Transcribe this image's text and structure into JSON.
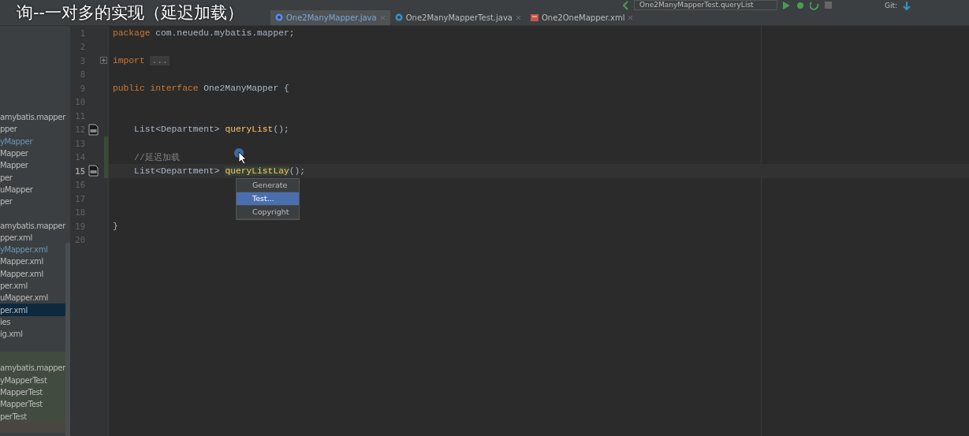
{
  "caption": "询--一对多的实现（延迟加载）",
  "toolbar": {
    "run_config": "One2ManyMapperTest.queryList",
    "vcs_label": "Git:"
  },
  "tabs": [
    {
      "label": "One2ManyMapper.java",
      "kind": "interface",
      "selected": true
    },
    {
      "label": "One2ManyMapperTest.java",
      "kind": "class",
      "selected": false
    },
    {
      "label": "One2OneMapper.xml",
      "kind": "xml",
      "selected": false
    }
  ],
  "sidebar": {
    "sections": [
      {
        "kind": "main",
        "items": [
          {
            "label": "amybatis.mapper",
            "color": "#bbbbbb",
            "selected": false
          },
          {
            "label": "pper",
            "color": "#bbbbbb",
            "selected": false
          },
          {
            "label": "yMapper",
            "color": "#6897bb",
            "selected": false
          },
          {
            "label": "Mapper",
            "color": "#bbbbbb",
            "selected": false
          },
          {
            "label": "Mapper",
            "color": "#bbbbbb",
            "selected": false
          },
          {
            "label": "per",
            "color": "#bbbbbb",
            "selected": false
          },
          {
            "label": "uMapper",
            "color": "#bbbbbb",
            "selected": false
          },
          {
            "label": "per",
            "color": "#bbbbbb",
            "selected": false
          }
        ]
      },
      {
        "kind": "main",
        "items": [
          {
            "label": "amybatis.mapper",
            "color": "#bbbbbb",
            "selected": false
          },
          {
            "label": "pper.xml",
            "color": "#bbbbbb",
            "selected": false
          },
          {
            "label": "yMapper.xml",
            "color": "#6897bb",
            "selected": false
          },
          {
            "label": "Mapper.xml",
            "color": "#bbbbbb",
            "selected": false
          },
          {
            "label": "Mapper.xml",
            "color": "#bbbbbb",
            "selected": false
          },
          {
            "label": "per.xml",
            "color": "#bbbbbb",
            "selected": false
          },
          {
            "label": "uMapper.xml",
            "color": "#bbbbbb",
            "selected": false
          },
          {
            "label": "per.xml",
            "color": "#bbbbbb",
            "selected": true
          },
          {
            "label": "ies",
            "color": "#bbbbbb",
            "selected": false
          },
          {
            "label": "ig.xml",
            "color": "#bbbbbb",
            "selected": false
          }
        ]
      },
      {
        "kind": "test",
        "items": [
          {
            "label": "amybatis.mapper",
            "color": "#bbbbbb",
            "selected": false
          },
          {
            "label": "yMapperTest",
            "color": "#bbbbbb",
            "selected": false
          },
          {
            "label": "MapperTest",
            "color": "#bbbbbb",
            "selected": false
          },
          {
            "label": "MapperTest",
            "color": "#bbbbbb",
            "selected": false
          },
          {
            "label": "perTest",
            "color": "#bbbbbb",
            "selected": false
          }
        ]
      }
    ]
  },
  "editor": {
    "lines": [
      {
        "number": "1",
        "fold_marker": false,
        "gutter_icon": false,
        "changed": false,
        "current": false,
        "tokens": [
          {
            "kind": "keyword",
            "text": "package"
          },
          {
            "kind": "plain",
            "text": " com.neuedu.mybatis.mapper;"
          }
        ]
      },
      {
        "number": "2",
        "fold_marker": false,
        "gutter_icon": false,
        "changed": false,
        "current": false
      },
      {
        "number": "3",
        "fold_marker": true,
        "gutter_icon": false,
        "changed": false,
        "current": false,
        "tokens": [
          {
            "kind": "keyword",
            "text": "import"
          },
          {
            "kind": "folded",
            "text": "..."
          }
        ]
      },
      {
        "number": "8",
        "fold_marker": false,
        "gutter_icon": false,
        "changed": false,
        "current": false
      },
      {
        "number": "9",
        "fold_marker": false,
        "gutter_icon": false,
        "changed": false,
        "current": false,
        "tokens": [
          {
            "kind": "keyword",
            "text": "public interface"
          },
          {
            "kind": "plain",
            "text": " One2ManyMapper {"
          }
        ]
      },
      {
        "number": "10",
        "fold_marker": false,
        "gutter_icon": false,
        "changed": false,
        "current": false
      },
      {
        "number": "11",
        "fold_marker": false,
        "gutter_icon": false,
        "changed": false,
        "current": false
      },
      {
        "number": "12",
        "fold_marker": false,
        "gutter_icon": true,
        "changed": false,
        "current": false,
        "tokens": [
          {
            "kind": "plain",
            "text": "    List<Department> "
          },
          {
            "kind": "method",
            "text": "queryList"
          },
          {
            "kind": "plain",
            "text": "();"
          }
        ]
      },
      {
        "number": "13",
        "fold_marker": false,
        "gutter_icon": false,
        "changed": true,
        "current": false
      },
      {
        "number": "14",
        "fold_marker": false,
        "gutter_icon": false,
        "changed": true,
        "current": false,
        "tokens": [
          {
            "kind": "comment",
            "text": "    //延迟加载"
          }
        ]
      },
      {
        "number": "15",
        "fold_marker": false,
        "gutter_icon": true,
        "changed": true,
        "current": true,
        "tokens": [
          {
            "kind": "plain",
            "text": "    List<Department> "
          },
          {
            "kind": "method",
            "text": "queryListLay"
          },
          {
            "kind": "plain",
            "text": "();"
          }
        ]
      },
      {
        "number": "16",
        "fold_marker": false,
        "gutter_icon": false,
        "changed": false,
        "current": false
      },
      {
        "number": "17",
        "fold_marker": false,
        "gutter_icon": false,
        "changed": false,
        "current": false
      },
      {
        "number": "18",
        "fold_marker": false,
        "gutter_icon": false,
        "changed": false,
        "current": false
      },
      {
        "number": "19",
        "fold_marker": false,
        "gutter_icon": false,
        "changed": false,
        "current": false,
        "tokens": [
          {
            "kind": "plain",
            "text": "}"
          }
        ]
      },
      {
        "number": "20",
        "fold_marker": false,
        "gutter_icon": false,
        "changed": false,
        "current": false
      }
    ]
  },
  "popup": {
    "items": [
      {
        "label": "Generate",
        "selected": false
      },
      {
        "label": "Test...",
        "selected": true
      },
      {
        "label": "Copyright",
        "selected": false
      }
    ]
  }
}
